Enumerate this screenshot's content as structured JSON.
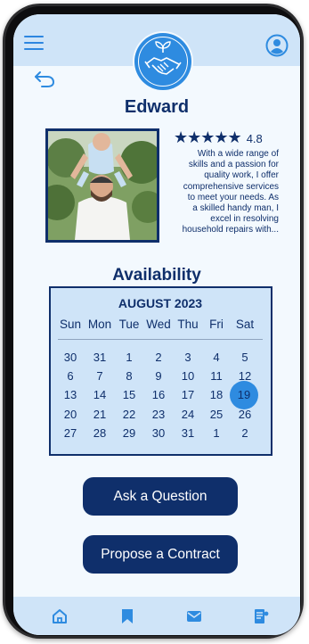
{
  "header": {
    "menu_icon": "hamburger-icon",
    "logo_icon": "handshake-plant-logo",
    "profile_icon": "user-circle-icon",
    "back_icon": "back-arrow-icon"
  },
  "profile": {
    "name": "Edward",
    "stars": "★★★★★",
    "rating": "4.8",
    "bio_lines": [
      "With a wide range of",
      "skills and a passion for",
      "quality work, I offer",
      "comprehensive services",
      "to meet your needs. As",
      "a skilled handy man, I",
      "excel in resolving",
      "household repairs with..."
    ]
  },
  "availability": {
    "title": "Availability",
    "month": "AUGUST  2023",
    "weekdays": [
      "Sun",
      "Mon",
      "Tue",
      "Wed",
      "Thu",
      "Fri",
      "Sat"
    ],
    "weeks": [
      [
        "30",
        "31",
        "1",
        "2",
        "3",
        "4",
        "5"
      ],
      [
        "6",
        "7",
        "8",
        "9",
        "10",
        "11",
        "12"
      ],
      [
        "13",
        "14",
        "15",
        "16",
        "17",
        "18",
        "19"
      ],
      [
        "20",
        "21",
        "22",
        "23",
        "24",
        "25",
        "26"
      ],
      [
        "27",
        "28",
        "29",
        "30",
        "31",
        "1",
        "2"
      ]
    ],
    "selected_day": "19"
  },
  "actions": {
    "ask_label": "Ask a Question",
    "propose_label": "Propose a Contract"
  },
  "bottom_nav": {
    "items": [
      "home-icon",
      "bookmark-icon",
      "mail-icon",
      "contract-icon"
    ]
  },
  "colors": {
    "navy": "#0f2f6b",
    "accent": "#2e8be0",
    "light_blue": "#cfe4f8",
    "background": "#f3f9fe"
  }
}
